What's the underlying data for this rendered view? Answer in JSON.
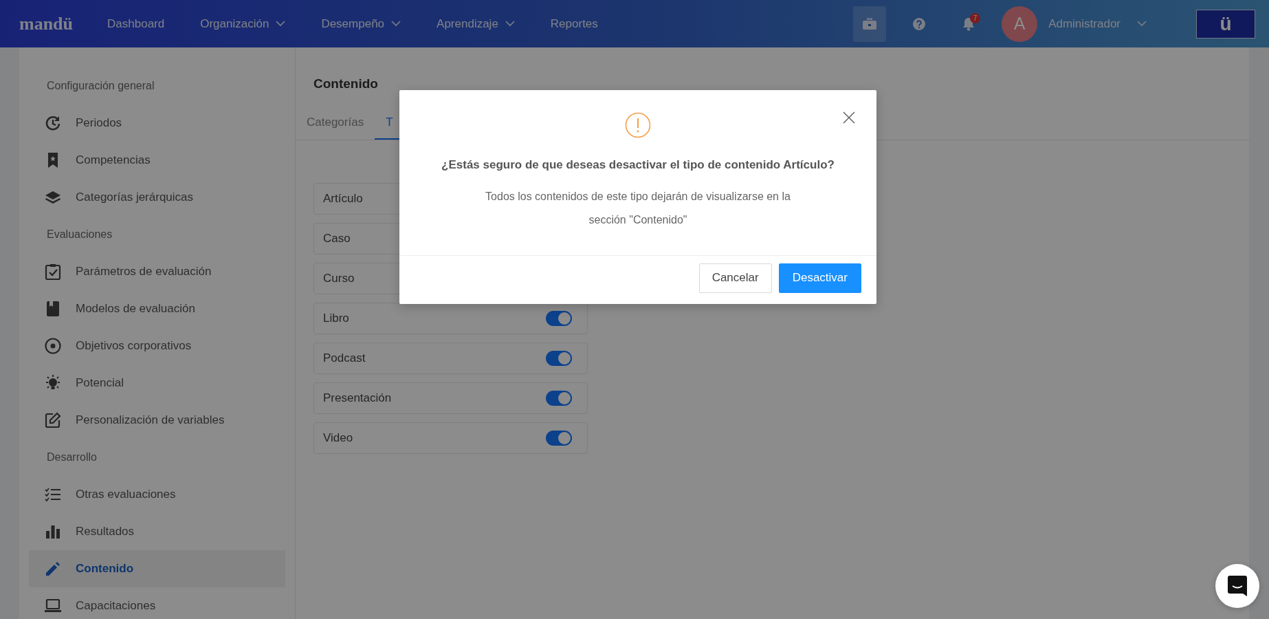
{
  "navbar": {
    "logo": "mandü",
    "menu": [
      {
        "label": "Dashboard",
        "dropdown": false
      },
      {
        "label": "Organización",
        "dropdown": true
      },
      {
        "label": "Desempeño",
        "dropdown": true
      },
      {
        "label": "Aprendizaje",
        "dropdown": true
      },
      {
        "label": "Reportes",
        "dropdown": false
      }
    ],
    "notifications": "7",
    "user": {
      "initial": "A",
      "name": "Administrador"
    },
    "brand_button": "ü"
  },
  "sidebar": {
    "sections": [
      {
        "title": "Configuración general",
        "items": [
          {
            "label": "Periodos",
            "selected": false
          },
          {
            "label": "Competencias",
            "selected": false
          },
          {
            "label": "Categorías jerárquicas",
            "selected": false
          }
        ]
      },
      {
        "title": "Evaluaciones",
        "items": [
          {
            "label": "Parámetros de evaluación",
            "selected": false
          },
          {
            "label": "Modelos de evaluación",
            "selected": false
          },
          {
            "label": "Objetivos corporativos",
            "selected": false
          },
          {
            "label": "Potencial",
            "selected": false
          },
          {
            "label": "Personalización de variables",
            "selected": false
          }
        ]
      },
      {
        "title": "Desarrollo",
        "items": [
          {
            "label": "Otras evaluaciones",
            "selected": false
          },
          {
            "label": "Resultados",
            "selected": false
          },
          {
            "label": "Contenido",
            "selected": true
          },
          {
            "label": "Capacitaciones",
            "selected": false
          }
        ]
      }
    ]
  },
  "content": {
    "title": "Contenido",
    "tabs": [
      {
        "label": "Categorías",
        "selected": false
      },
      {
        "label": "T",
        "selected": true
      }
    ],
    "types": [
      {
        "name": "Artículo"
      },
      {
        "name": "Caso"
      },
      {
        "name": "Curso"
      },
      {
        "name": "Libro",
        "on": true
      },
      {
        "name": "Podcast",
        "on": true
      },
      {
        "name": "Presentación",
        "on": true
      },
      {
        "name": "Video",
        "on": true
      }
    ]
  },
  "dialog": {
    "title": "¿Estás seguro de que deseas desactivar el tipo de contenido Artículo?",
    "message": "Todos los contenidos de este tipo dejarán de visualizarse en la sección \"Contenido\"",
    "buttons": [
      {
        "label": "Cancelar",
        "kind": "secondary"
      },
      {
        "label": "Desactivar",
        "kind": "primary"
      }
    ]
  }
}
